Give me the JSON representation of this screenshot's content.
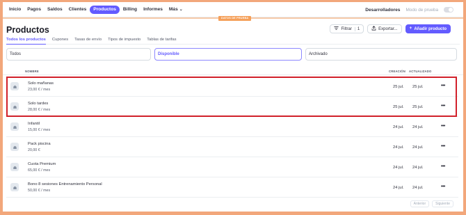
{
  "nav": {
    "items": [
      {
        "label": "Inicio",
        "active": false
      },
      {
        "label": "Pagos",
        "active": false
      },
      {
        "label": "Saldos",
        "active": false
      },
      {
        "label": "Clientes",
        "active": false
      },
      {
        "label": "Productos",
        "active": true
      },
      {
        "label": "Billing",
        "active": false
      },
      {
        "label": "Informes",
        "active": false
      }
    ],
    "more_label": "Más",
    "developers_label": "Desarrolladores",
    "test_mode_label": "Modo de prueba",
    "test_mode_on": false
  },
  "test_badge": "DATOS DE PRUEBA",
  "page": {
    "title": "Productos",
    "filter_label": "Filtrar",
    "filter_count": "1",
    "export_label": "Exportar...",
    "add_label": "Añadir producto"
  },
  "tabs": [
    "Todos los productos",
    "Cupones",
    "Tasas de envío",
    "Tipos de impuesto",
    "Tablas de tarifas"
  ],
  "active_tab": 0,
  "filters": [
    "Todos",
    "Disponible",
    "Archivado"
  ],
  "active_filter": 1,
  "table": {
    "col_name": "NOMBRE",
    "col_created": "CREACIÓN",
    "col_updated": "ACTUALIZADO",
    "rows": [
      {
        "name": "Solo mañanas",
        "price": "23,00 € / mes",
        "created": "25 jul.",
        "updated": "25 jul."
      },
      {
        "name": "Solo tardes",
        "price": "28,00 € / mes",
        "created": "25 jul.",
        "updated": "25 jul."
      },
      {
        "name": "Infantil",
        "price": "15,00 € / mes",
        "created": "24 jul.",
        "updated": "24 jul."
      },
      {
        "name": "Pack piscina",
        "price": "20,00 €",
        "created": "24 jul.",
        "updated": "24 jul."
      },
      {
        "name": "Cuota Premium",
        "price": "65,00 € / mes",
        "created": "24 jul.",
        "updated": "24 jul."
      },
      {
        "name": "Bono 8 sesiones Entrenamiento Personal",
        "price": "50,00 € / mes",
        "created": "24 jul.",
        "updated": "24 jul."
      }
    ],
    "more_glyph": "•••"
  },
  "pagination": {
    "prev": "Anterior",
    "next": "Siguiente"
  },
  "colors": {
    "accent": "#635bff",
    "highlight": "#d1202a",
    "frame": "#f2a77b"
  }
}
